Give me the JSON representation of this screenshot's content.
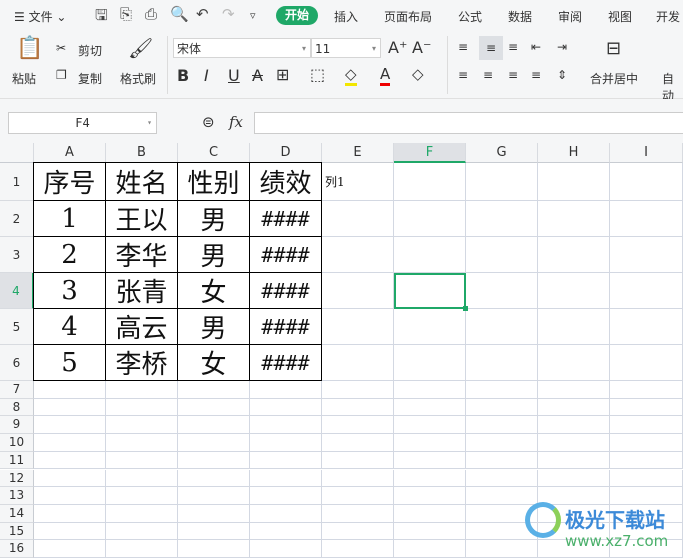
{
  "menu": {
    "file": "文件",
    "tabs": [
      "开始",
      "插入",
      "页面布局",
      "公式",
      "数据",
      "审阅",
      "视图",
      "开发"
    ]
  },
  "ribbon": {
    "paste": "粘贴",
    "cut": "剪切",
    "copy": "复制",
    "format_painter": "格式刷",
    "font": "宋体",
    "size": "11",
    "merge": "合并居中",
    "wrap": "自动"
  },
  "formula": {
    "namebox": "F4",
    "fx": "fx",
    "value": ""
  },
  "colors": {
    "accent": "#1fa868",
    "grid": "#d3d8e2"
  },
  "columns": [
    "A",
    "B",
    "C",
    "D",
    "E",
    "F",
    "G",
    "H",
    "I"
  ],
  "rows": [
    "1",
    "2",
    "3",
    "4",
    "5",
    "6",
    "7",
    "8",
    "9",
    "10",
    "11",
    "12",
    "13",
    "14",
    "15",
    "16"
  ],
  "table": {
    "header": [
      "序号",
      "姓名",
      "性别",
      "绩效"
    ],
    "rows": [
      [
        "1",
        "王以",
        "男",
        "####"
      ],
      [
        "2",
        "李华",
        "男",
        "####"
      ],
      [
        "3",
        "张青",
        "女",
        "####"
      ],
      [
        "4",
        "高云",
        "男",
        "####"
      ],
      [
        "5",
        "李桥",
        "女",
        "####"
      ]
    ]
  },
  "e1": "列1",
  "watermark": {
    "name": "极光下载站",
    "url": "www.xz7.com"
  }
}
